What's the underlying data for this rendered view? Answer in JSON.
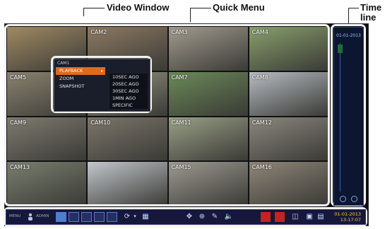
{
  "callouts": {
    "video_window": "Video Window",
    "quick_menu": "Quick Menu",
    "timeline": "Time line"
  },
  "cameras": [
    {
      "label": "",
      "color": "#a08a63"
    },
    {
      "label": "CAM2",
      "color": "#8d7a62"
    },
    {
      "label": "CAM3",
      "color": "#a29c8e"
    },
    {
      "label": "CAM4",
      "color": "#88a06c"
    },
    {
      "label": "CAM5",
      "color": "#8b8270"
    },
    {
      "label": "",
      "color": "#9a9684"
    },
    {
      "label": "CAM7",
      "color": "#6b8a58"
    },
    {
      "label": "CAM8",
      "color": "#b7bcc2"
    },
    {
      "label": "CAM9",
      "color": "#7f7b6f"
    },
    {
      "label": "CAM10",
      "color": "#7c766b"
    },
    {
      "label": "CAM11",
      "color": "#9aa086"
    },
    {
      "label": "CAM12",
      "color": "#8c887e"
    },
    {
      "label": "CAM13",
      "color": "#7a7f6e"
    },
    {
      "label": "",
      "color": "#c3c7cc"
    },
    {
      "label": "CAM15",
      "color": "#9d9a90"
    },
    {
      "label": "CAM16",
      "color": "#8f8678"
    }
  ],
  "quick_menu": {
    "title": "CAM1",
    "items": [
      {
        "label": "PLAYBACK",
        "selected": true
      },
      {
        "label": "ZOOM",
        "selected": false
      },
      {
        "label": "SNAPSHOT",
        "selected": false
      }
    ],
    "submenu": [
      "10SEC AGO",
      "20SEC AGO",
      "30SEC AGO",
      "1MIN AGO",
      "SPECIFIC"
    ]
  },
  "timeline": {
    "date": "01-01-2013"
  },
  "toolbar": {
    "menu_label": "MENU",
    "user_label": "ADMIN",
    "date": "01-01-2013",
    "time": "13:17:07",
    "accent": "#ffcc33",
    "record_color": "#c62222"
  }
}
